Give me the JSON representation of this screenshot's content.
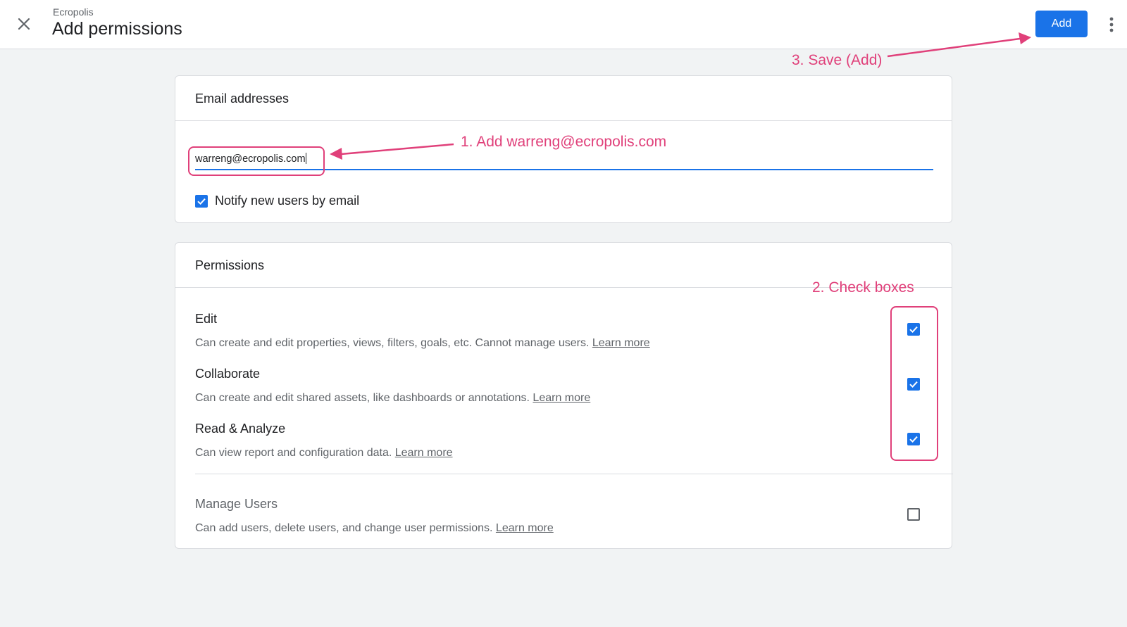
{
  "header": {
    "subtitle": "Ecropolis",
    "title": "Add permissions",
    "add_label": "Add",
    "close_icon": "close-icon",
    "more_icon": "more-vert-icon"
  },
  "email_section": {
    "heading": "Email addresses",
    "email_value": "warreng@ecropolis.com",
    "notify_label": "Notify new users by email",
    "notify_checked": true
  },
  "permissions_section": {
    "heading": "Permissions",
    "learn_more": "Learn more",
    "items": [
      {
        "title": "Edit",
        "description": "Can create and edit properties, views, filters, goals, etc. Cannot manage users.",
        "checked": true
      },
      {
        "title": "Collaborate",
        "description": "Can create and edit shared assets, like dashboards or annotations.",
        "checked": true
      },
      {
        "title": "Read & Analyze",
        "description": "Can view report and configuration data.",
        "checked": true
      },
      {
        "title": "Manage Users",
        "description": "Can add users, delete users, and change user permissions.",
        "checked": false
      }
    ]
  },
  "annotations": {
    "step1": "1. Add warreng@ecropolis.com",
    "step2": "2. Check boxes",
    "step3": "3. Save (Add)"
  },
  "colors": {
    "accent": "#1a73e8",
    "annotation": "#e0407a",
    "background": "#f1f3f4"
  }
}
